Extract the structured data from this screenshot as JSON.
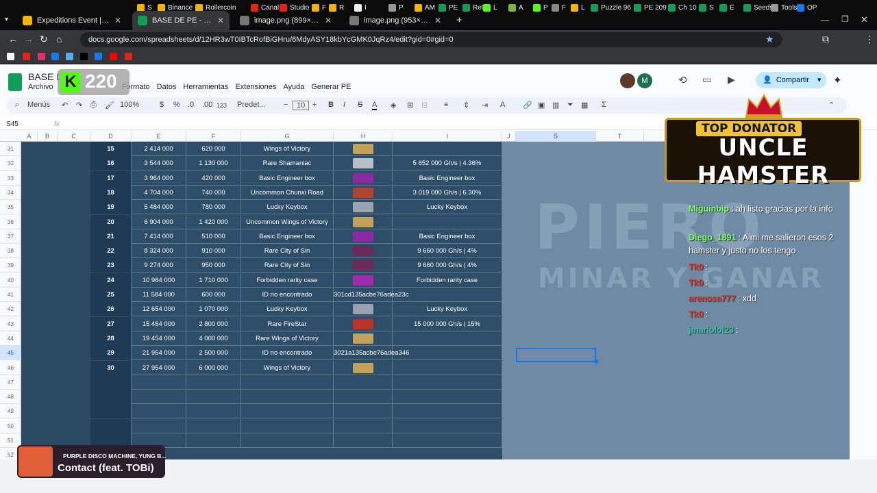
{
  "browser": {
    "tabs": [
      {
        "title": "Expeditions Event | RollerCoin",
        "icon_color": "#f5b400"
      },
      {
        "title": "BASE DE PE - Hojas de cálculo de Google",
        "icon_color": "#0f9d58"
      },
      {
        "title": "image.png (899×720)",
        "icon_color": "#777777"
      },
      {
        "title": "image.png (953×358)",
        "icon_color": "#777777"
      }
    ],
    "url": "docs.google.com/spreadsheets/d/12HR3wT0IBTcRofBiGHru/6MdyASY18kbYcGMK0JqRz4/edit?gid=0#gid=0",
    "bookmarks": [
      "S",
      "Binance",
      "Rollercoin",
      "Canal",
      "Studio",
      "F",
      "R",
      "I",
      "P",
      "AM",
      "PE",
      "Reto",
      "L",
      "A",
      "P",
      "F",
      "L",
      "Puzzle 96",
      "PE 209",
      "Ch 10",
      "S",
      "E",
      "Seeds",
      "Tools",
      "OP"
    ]
  },
  "sheets": {
    "doc_title": "BASE DE P",
    "menus": [
      "Archivo",
      "Formato",
      "Datos",
      "Herramientas",
      "Extensiones",
      "Ayuda",
      "Generar PE"
    ],
    "toolbar": {
      "search": "Menús",
      "zoom": "100%",
      "currency": "$",
      "percent": "%",
      "dec_less": ".0",
      "dec_more": ".00",
      "numfmt": "123",
      "font": "Predet...",
      "font_size": "10",
      "share": "Compartir"
    },
    "name_box": "S45",
    "fx": "fx",
    "avatar_initial": "M",
    "columns": [
      "A",
      "B",
      "C",
      "D",
      "E",
      "F",
      "G",
      "H",
      "I",
      "J",
      "S",
      "T"
    ],
    "row_numbers": [
      "31",
      "32",
      "33",
      "34",
      "35",
      "36",
      "37",
      "38",
      "39",
      "40",
      "41",
      "42",
      "43",
      "44",
      "45",
      "46",
      "47",
      "48",
      "49",
      "50",
      "51",
      "52"
    ],
    "rows": [
      {
        "d": "15",
        "e": "2 414 000",
        "f": "620 000",
        "g": "Wings of Victory",
        "h": "",
        "i": "",
        "thumb": "#c2a25a"
      },
      {
        "d": "16",
        "e": "3 544 000",
        "f": "1 130 000",
        "g": "Rare Shamaniac",
        "h": "",
        "i": "5 652 000 Gh/s | 4.36%",
        "thumb": "#b7c0c8"
      },
      {
        "d": "17",
        "e": "3 964 000",
        "f": "420 000",
        "g": "Basic Engineer box",
        "h": "",
        "i": "Basic Engineer box",
        "thumb": "#8a2aa0"
      },
      {
        "d": "18",
        "e": "4 704 000",
        "f": "740 000",
        "g": "Uncommon Chunxi Road",
        "h": "",
        "i": "3 019 000 Gh/s | 6.30%",
        "thumb": "#b0442e"
      },
      {
        "d": "19",
        "e": "5 484 000",
        "f": "780 000",
        "g": "Lucky Keybox",
        "h": "",
        "i": "Lucky Keybox",
        "thumb": "#9aa3ad"
      },
      {
        "d": "20",
        "e": "6 904 000",
        "f": "1 420 000",
        "g": "Uncommon Wings of Victory",
        "h": "",
        "i": "",
        "thumb": "#c2a25a"
      },
      {
        "d": "21",
        "e": "7 414 000",
        "f": "510 000",
        "g": "Basic Engineer box",
        "h": "",
        "i": "Basic Engineer box",
        "thumb": "#8a2aa0"
      },
      {
        "d": "22",
        "e": "8 324 000",
        "f": "910 000",
        "g": "Rare City of Sin",
        "h": "",
        "i": "9 660 000 Gh/s | 4%",
        "thumb": "#6a2a5a"
      },
      {
        "d": "23",
        "e": "9 274 000",
        "f": "950 000",
        "g": "Rare City of Sin",
        "h": "",
        "i": "9 660 000 Gh/s | 4%",
        "thumb": "#6a2a5a"
      },
      {
        "d": "24",
        "e": "10 984 000",
        "f": "1 710 000",
        "g": "Forbidden rarity case",
        "h": "",
        "i": "Forbidden rarity case",
        "thumb": "#a02ab0"
      },
      {
        "d": "25",
        "e": "11 584 000",
        "f": "600 000",
        "g": "ID no encontrado",
        "h": "301cd135acbe76adea23c",
        "i": "",
        "thumb": ""
      },
      {
        "d": "26",
        "e": "12 654 000",
        "f": "1 070 000",
        "g": "Lucky Keybox",
        "h": "",
        "i": "Lucky Keybox",
        "thumb": "#9aa3ad"
      },
      {
        "d": "27",
        "e": "15 454 000",
        "f": "2 800 000",
        "g": "Rare FireStar",
        "h": "",
        "i": "15 000 000 Gh/s | 15%",
        "thumb": "#c0302a"
      },
      {
        "d": "28",
        "e": "19 454 000",
        "f": "4 000 000",
        "g": "Rare Wings of Victory",
        "h": "",
        "i": "",
        "thumb": "#c2a25a"
      },
      {
        "d": "29",
        "e": "21 954 000",
        "f": "2 500 000",
        "g": "ID no encontrado",
        "h": "3021a135acbe76adea346",
        "i": "",
        "thumb": ""
      },
      {
        "d": "30",
        "e": "27 954 000",
        "f": "6 000 000",
        "g": "Wings of Victory",
        "h": "",
        "i": "",
        "thumb": "#c2a25a"
      },
      {
        "d": "",
        "e": "",
        "f": "",
        "g": "",
        "h": "",
        "i": "",
        "thumb": ""
      },
      {
        "d": "",
        "e": "",
        "f": "",
        "g": "",
        "h": "",
        "i": "",
        "thumb": ""
      },
      {
        "d": "",
        "e": "",
        "f": "",
        "g": "",
        "h": "",
        "i": "",
        "thumb": ""
      },
      {
        "d": "",
        "e": "",
        "f": "",
        "g": "",
        "h": "",
        "i": "",
        "thumb": ""
      },
      {
        "d": "",
        "e": "",
        "f": "",
        "g": "",
        "h": "",
        "i": "",
        "thumb": ""
      }
    ]
  },
  "stream": {
    "kick_count": "220",
    "donator_top": "TOP DONATOR",
    "donator_name": "UNCLE HAMSTER",
    "watermark_1": "PIERO",
    "watermark_2": "MINAR Y GANAR",
    "chat": [
      {
        "user": "Miguinbip",
        "msg": ": ah listo gracias por la info",
        "color": "#7cff6b"
      },
      {
        "user": "Diego_1891",
        "msg": ": A mi me salieron esos 2 hamster y justo no los tengo",
        "color": "#7cff6b"
      },
      {
        "user": "Tk0",
        "msg": ":",
        "color": "#e2362b"
      },
      {
        "user": "Tk0",
        "msg": ":",
        "color": "#e2362b"
      },
      {
        "user": "arenosa777",
        "msg": ": xdd",
        "color": "#e2362b"
      },
      {
        "user": "Tk0",
        "msg": ":",
        "color": "#e2362b"
      },
      {
        "user": "jmariolol23",
        "msg": ":",
        "color": "#39c6a3"
      }
    ],
    "music_artist": "PURPLE DISCO MACHINE, YUNG B...",
    "music_title": "Contact (feat. TOBi)"
  }
}
